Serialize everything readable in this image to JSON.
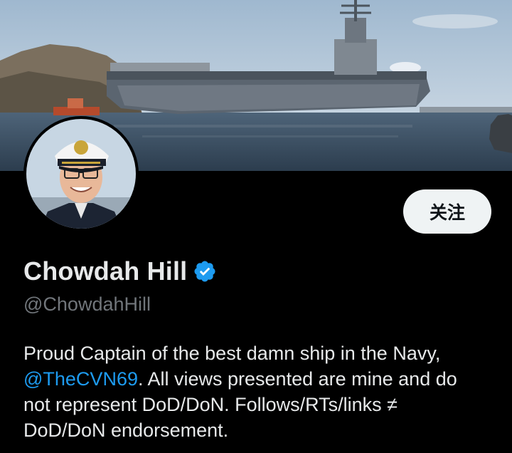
{
  "profile": {
    "display_name": "Chowdah Hill",
    "handle": "@ChowdahHill",
    "verified": true,
    "follow_label": "关注",
    "bio": {
      "line1": "Proud Captain of the best damn ship in the Navy,",
      "mention": "@TheCVN69",
      "line2_rest": ". All views presented are mine and do",
      "line3": "not represent DoD/DoN. Follows/RTs/links ≠",
      "line4": "DoD/DoN endorsement."
    }
  },
  "colors": {
    "background": "#000000",
    "text": "#e7e9ea",
    "secondary_text": "#71767b",
    "link": "#1d9bf0",
    "verified": "#1d9bf0",
    "button_bg": "#eff3f4"
  }
}
